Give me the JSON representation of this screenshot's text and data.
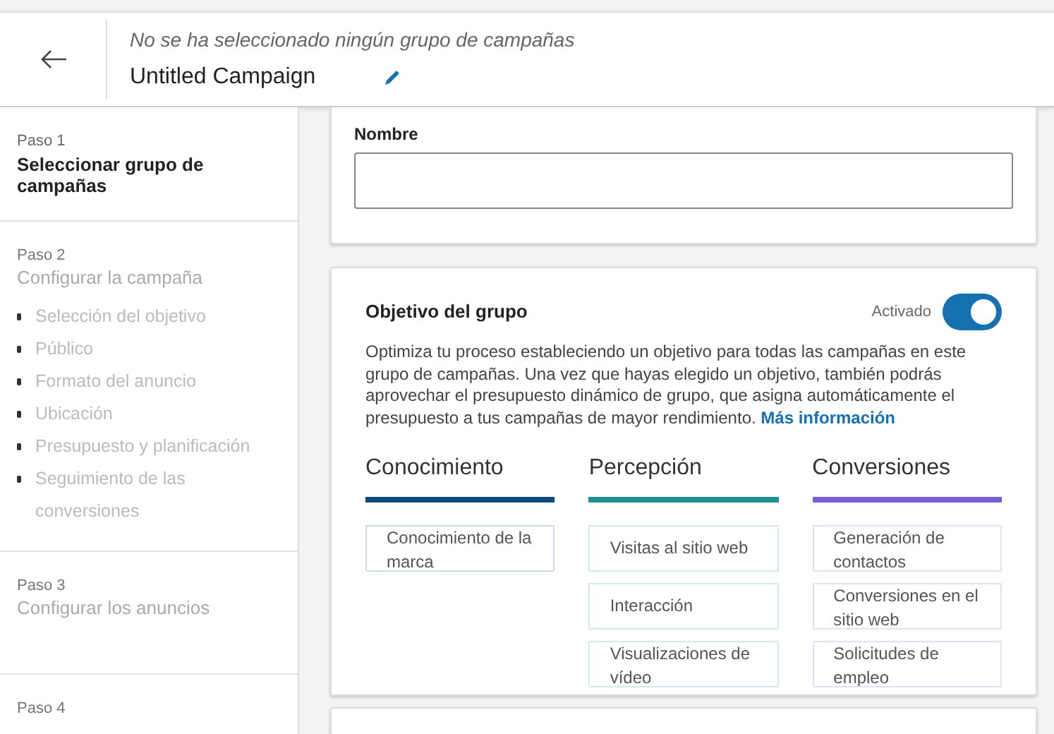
{
  "header": {
    "subtitle": "No se ha seleccionado ningún grupo de campañas",
    "title": "Untitled Campaign"
  },
  "steps": [
    {
      "label": "Paso 1",
      "title": "Seleccionar grupo de campañas",
      "active": true
    },
    {
      "label": "Paso 2",
      "title": "Configurar la campaña",
      "active": false,
      "substeps": [
        "Selección del objetivo",
        "Público",
        "Formato del anuncio",
        "Ubicación",
        "Presupuesto y planificación",
        "Seguimiento de las conversiones"
      ]
    },
    {
      "label": "Paso 3",
      "title": "Configurar los anuncios",
      "active": false
    },
    {
      "label": "Paso 4",
      "active": false
    }
  ],
  "name_field": {
    "label": "Nombre"
  },
  "objective": {
    "title": "Objetivo del grupo",
    "toggle_label": "Activado",
    "on": true,
    "description": "Optimiza tu proceso estableciendo un objetivo para todas las campañas en este grupo de campañas. Una vez que hayas elegido un objetivo, también podrás aprovechar el presupuesto dinámico de grupo, que asigna automáticamente el presupuesto a tus campañas de mayor rendimiento.",
    "link": "Más información",
    "categories": [
      {
        "name": "Conocimiento",
        "color": "#0e4a7a",
        "options": [
          "Conocimiento de la marca"
        ]
      },
      {
        "name": "Percepción",
        "color": "#1f9191",
        "options": [
          "Visitas al sitio web",
          "Interacción",
          "Visualizaciones de vídeo"
        ]
      },
      {
        "name": "Conversiones",
        "color": "#7a5fd6",
        "options": [
          "Generación de contactos",
          "Conversiones en el sitio web",
          "Solicitudes de empleo"
        ]
      }
    ]
  }
}
